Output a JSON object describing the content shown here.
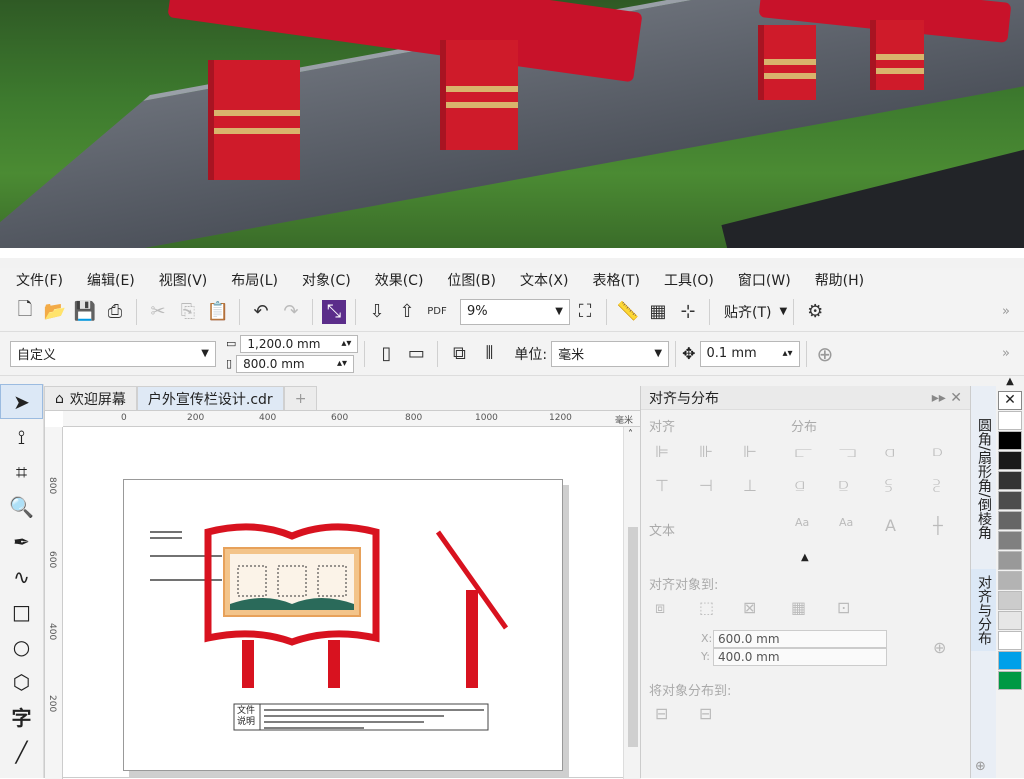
{
  "menu": [
    "文件(F)",
    "编辑(E)",
    "视图(V)",
    "布局(L)",
    "对象(C)",
    "效果(C)",
    "位图(B)",
    "文本(X)",
    "表格(T)",
    "工具(O)",
    "窗口(W)",
    "帮助(H)"
  ],
  "toolbar1": {
    "zoom": "9%",
    "snap_label": "贴齐(T)"
  },
  "toolbar2": {
    "preset": "自定义",
    "width": "1,200.0 mm",
    "height": "800.0 mm",
    "units_label": "单位:",
    "units": "毫米",
    "nudge": "0.1 mm"
  },
  "tabs": [
    "欢迎屏幕",
    "户外宣传栏设计.cdr"
  ],
  "hruler": {
    "labels": [
      "0",
      "200",
      "400",
      "600",
      "800",
      "1000",
      "1200"
    ],
    "unit": "毫米"
  },
  "vruler": {
    "labels": [
      "800",
      "600",
      "400",
      "200"
    ]
  },
  "doc": {
    "caption_line1": "文件",
    "caption_line2": "说明"
  },
  "docker": {
    "title": "对齐与分布",
    "align": "对齐",
    "distribute": "分布",
    "text": "文本",
    "align_to": "对齐对象到:",
    "x": "600.0 mm",
    "y": "400.0 mm",
    "x_label": "X:",
    "y_label": "Y:",
    "distribute_to": "将对象分布到:"
  },
  "sidetabs": [
    "圆角/扇形角/倒棱角",
    "对齐与分布"
  ],
  "palette": [
    "#ffffff",
    "#000000",
    "#1a1a1a",
    "#333333",
    "#4d4d4d",
    "#666666",
    "#808080",
    "#999999",
    "#b3b3b3",
    "#cccccc",
    "#e6e6e6",
    "#ffffff",
    "#00a0e9",
    "#009944"
  ]
}
